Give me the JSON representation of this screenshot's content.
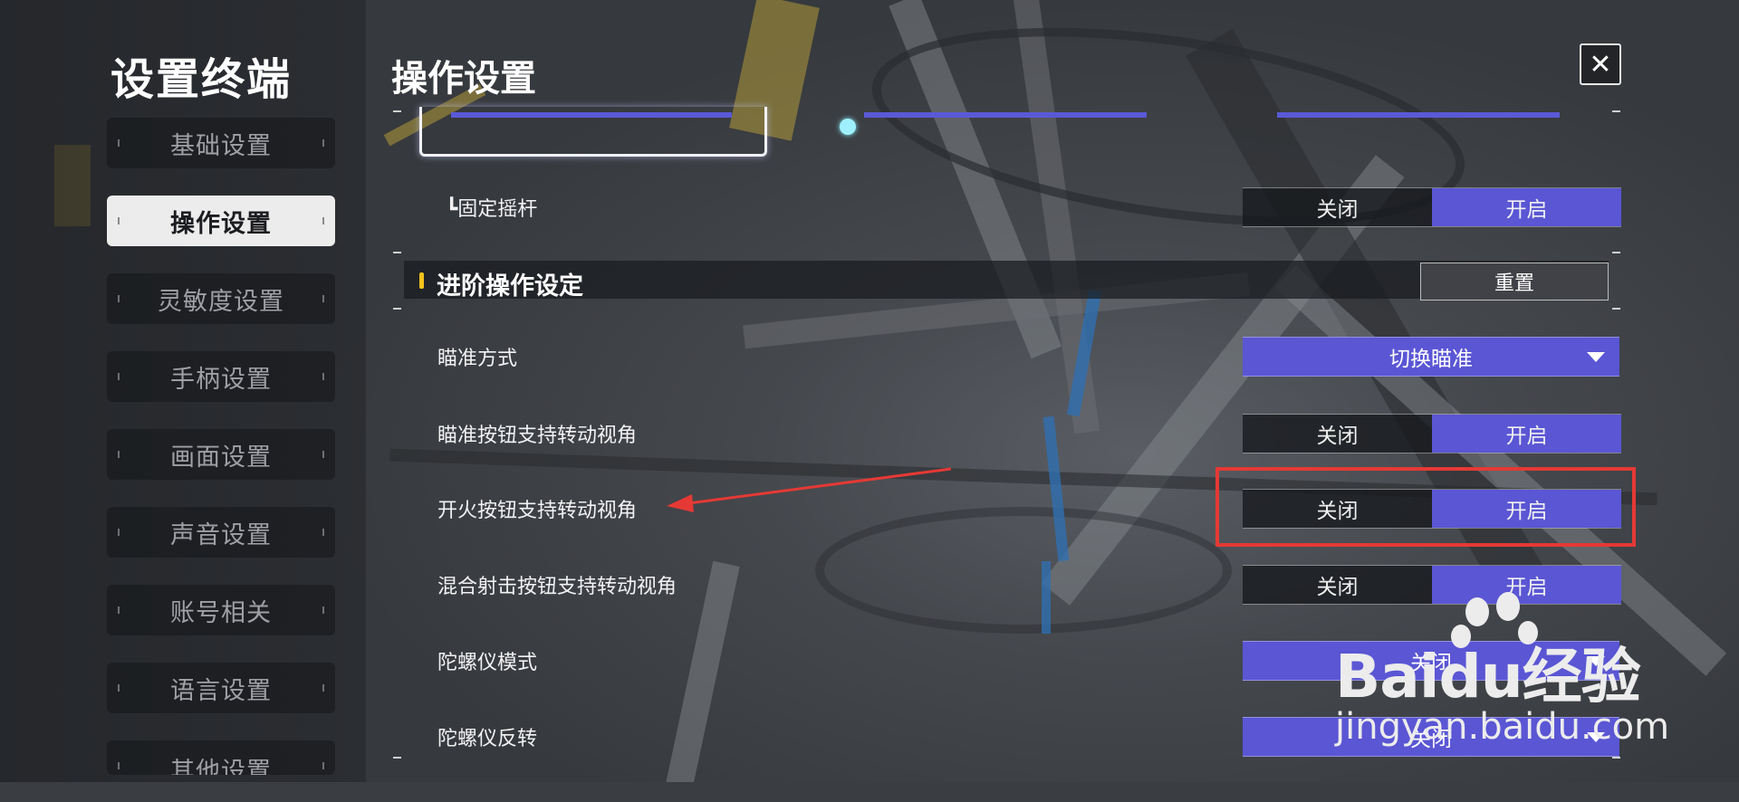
{
  "app_title": "设置终端",
  "nav": {
    "items": [
      {
        "label": "基础设置",
        "active": false
      },
      {
        "label": "操作设置",
        "active": true
      },
      {
        "label": "灵敏度设置",
        "active": false
      },
      {
        "label": "手柄设置",
        "active": false
      },
      {
        "label": "画面设置",
        "active": false
      },
      {
        "label": "声音设置",
        "active": false
      },
      {
        "label": "账号相关",
        "active": false
      },
      {
        "label": "语言设置",
        "active": false
      },
      {
        "label": "其他设置",
        "active": false
      }
    ]
  },
  "panel": {
    "title": "操作设置",
    "close_glyph": "✕"
  },
  "settings": {
    "fixed_joystick": {
      "label": "┗固定摇杆",
      "off": "关闭",
      "on": "开启",
      "state": "on"
    },
    "section": {
      "title": "进阶操作设定",
      "reset": "重置"
    },
    "aim_mode": {
      "label": "瞄准方式",
      "value": "切换瞄准"
    },
    "aim_button_rotate": {
      "label": "瞄准按钮支持转动视角",
      "off": "关闭",
      "on": "开启",
      "state": "on"
    },
    "fire_button_rotate": {
      "label": "开火按钮支持转动视角",
      "off": "关闭",
      "on": "开启",
      "state": "on"
    },
    "mixed_shoot_rotate": {
      "label": "混合射击按钮支持转动视角",
      "off": "关闭",
      "on": "开启",
      "state": "on"
    },
    "gyro_mode": {
      "label": "陀螺仪模式",
      "value": "关闭"
    },
    "gyro_invert": {
      "label": "陀螺仪反转",
      "value": "关闭"
    }
  },
  "colors": {
    "accent": "#5a56d4",
    "highlight": "#e53935",
    "section_marker": "#f3c21d"
  },
  "watermark": {
    "brand": "Baidu经验",
    "url": "jingyan.baidu.com"
  }
}
